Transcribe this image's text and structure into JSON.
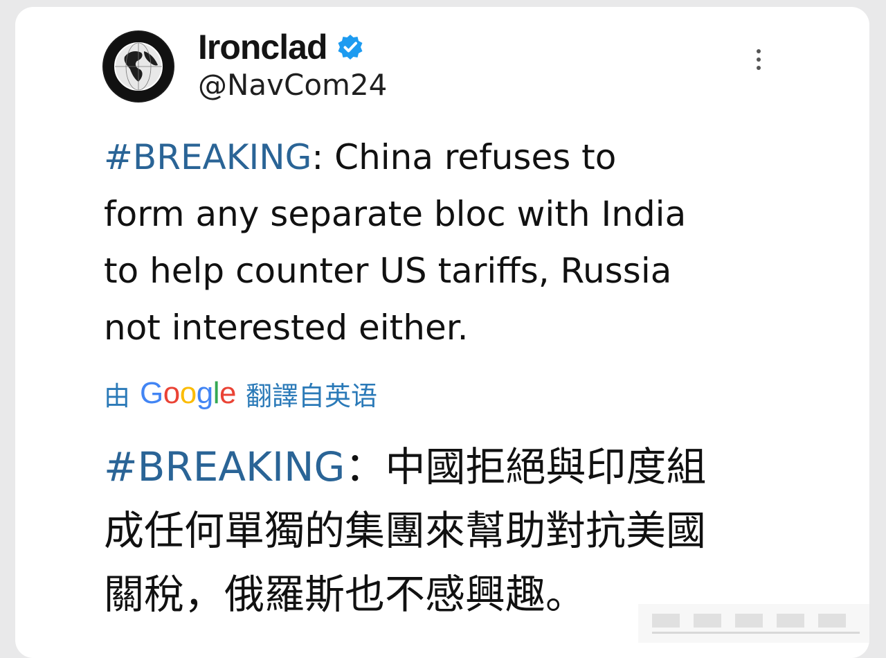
{
  "account": {
    "display_name": "Ironclad",
    "handle": "@NavCom24",
    "verified": true,
    "avatar_icon": "globe-icon"
  },
  "tweet": {
    "hashtag": "#BREAKING",
    "en_lines": [
      ": China refuses to",
      "form any separate bloc with India",
      "to help counter US tariffs, Russia",
      "not interested either."
    ],
    "translation_label_prefix": "由",
    "translation_provider": "Google",
    "translation_label_suffix": "翻譯自英语",
    "zh_hashtag": "#BREAKING",
    "zh_lines": [
      "：中國拒絕與印度組",
      "成任何單獨的集團來幫助對抗美國",
      "關稅，俄羅斯也不感興趣。"
    ]
  },
  "colors": {
    "hashtag": "#2a6496",
    "translation_label": "#2b7ab8",
    "verified_badge": "#1d9bf0",
    "text": "#111111"
  }
}
